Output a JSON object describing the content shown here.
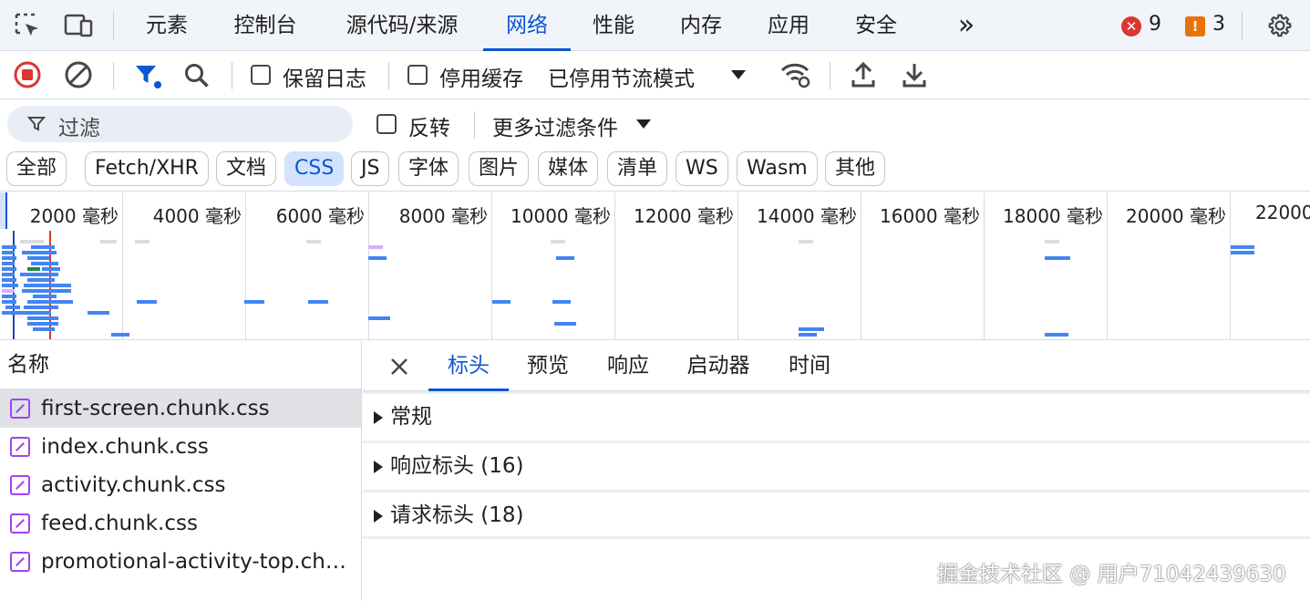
{
  "top_tabs": [
    "元素",
    "控制台",
    "源代码/来源",
    "网络",
    "性能",
    "内存",
    "应用",
    "安全"
  ],
  "active_tab": "网络",
  "more_tabs_glyph": "»",
  "errors_count": "9",
  "warnings_count": "3",
  "toolbar": {
    "preserve_log_label": "保留日志",
    "disable_cache_label": "停用缓存",
    "throttling_label": "已停用节流模式"
  },
  "filter": {
    "placeholder": "过滤",
    "invert_label": "反转",
    "more_filters_label": "更多过滤条件"
  },
  "type_chips": [
    "全部",
    "Fetch/XHR",
    "文档",
    "CSS",
    "JS",
    "字体",
    "图片",
    "媒体",
    "清单",
    "WS",
    "Wasm",
    "其他"
  ],
  "active_chip": "CSS",
  "overview_ticks": [
    "2000 毫秒",
    "4000 毫秒",
    "6000 毫秒",
    "8000 毫秒",
    "10000 毫秒",
    "12000 毫秒",
    "14000 毫秒",
    "16000 毫秒",
    "18000 毫秒",
    "20000 毫秒",
    "22000"
  ],
  "name_header": "名称",
  "files": [
    "first-screen.chunk.css",
    "index.chunk.css",
    "activity.chunk.css",
    "feed.chunk.css",
    "promotional-activity-top.chunk.css"
  ],
  "selected_file": "first-screen.chunk.css",
  "detail_tabs": [
    "标头",
    "预览",
    "响应",
    "启动器",
    "时间"
  ],
  "active_detail_tab": "标头",
  "sections": [
    "常规",
    "响应标头 (16)",
    "请求标头 (18)"
  ],
  "watermark": "掘金技术社区 @ 用户71042439630",
  "colors": {
    "accent": "#0b57d0",
    "error": "#dc362e",
    "warning": "#e8710a",
    "record": "#dc362e",
    "css_icon": "#a142f4",
    "bar_blue": "#4285f4",
    "bar_green": "#1e8e3e"
  }
}
